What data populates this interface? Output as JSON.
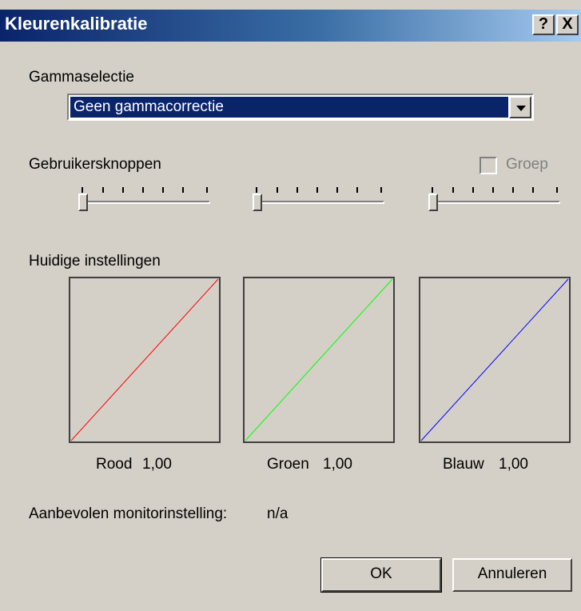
{
  "window": {
    "title": "Kleurenkalibratie",
    "help_label": "?",
    "close_label": "X"
  },
  "gamma": {
    "label": "Gammaselectie",
    "selected": "Geen gammacorrectie"
  },
  "user_controls": {
    "label": "Gebruikersknoppen",
    "group_label": "Groep",
    "group_checked": false,
    "slider_levels": [
      0,
      0,
      0
    ]
  },
  "current": {
    "label": "Huidige instellingen",
    "channels": [
      {
        "name": "Rood",
        "value": "1,00",
        "color": "#ff0000"
      },
      {
        "name": "Groen",
        "value": "1,00",
        "color": "#00ff00"
      },
      {
        "name": "Blauw",
        "value": "1,00",
        "color": "#0000ff"
      }
    ]
  },
  "monitor": {
    "label": "Aanbevolen monitorinstelling:",
    "value": "n/a"
  },
  "buttons": {
    "ok": "OK",
    "cancel": "Annuleren"
  }
}
